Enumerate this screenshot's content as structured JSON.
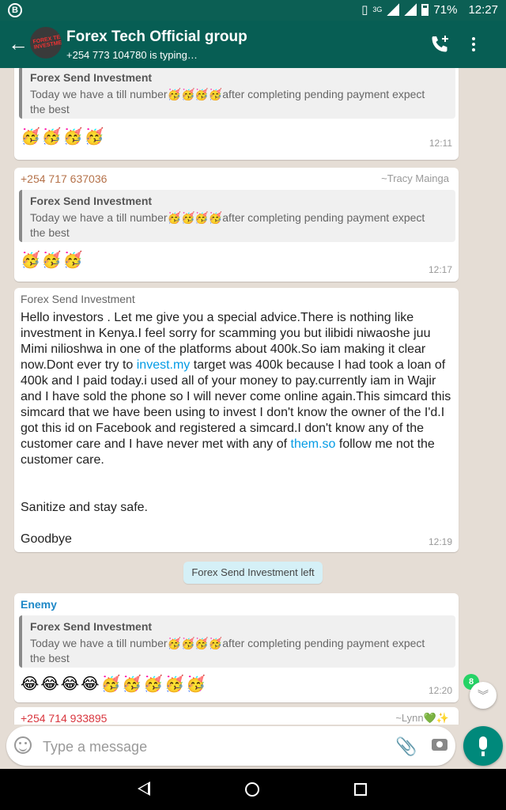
{
  "status_bar": {
    "network": "3G",
    "battery": "71%",
    "time": "12:27"
  },
  "header": {
    "back_icon": "arrow-left-icon",
    "avatar_text": "FOREX TECH INVESTMENT",
    "title": "Forex Tech Official group",
    "subtitle": "+254 773 104780 is typing…",
    "call_icon": "add-call-icon",
    "menu_icon": "more-vert-icon"
  },
  "messages": [
    {
      "quote_name": "Forex Send Investment",
      "quote_text": "Today we have a till number🥳🥳🥳🥳after completing pending payment expect the best",
      "emojis": "🥳🥳🥳🥳",
      "time": "12:11"
    },
    {
      "sender": "+254 717 637036",
      "alias": "~Tracy Mainga",
      "quote_name": "Forex Send Investment",
      "quote_text": "Today we have a till number🥳🥳🥳🥳after completing pending payment expect the best",
      "emojis": "🥳🥳🥳",
      "time": "12:17"
    },
    {
      "sender": "Forex Send Investment",
      "text_a": "Hello investors . Let me give you a special advice.There is nothing like investment in Kenya.I feel sorry for scamming you but ilibidi niwaoshe juu Mimi nilioshwa in one of the platforms about 400k.So iam making it clear now.Dont ever try to ",
      "link_a": "invest.my",
      "text_b": " target was 400k because I had took a loan of 400k and I paid today.i used all of your money to pay.currently iam in Wajir and I have sold the phone so I will never come online again.This simcard this simcard that we have been using to invest I don't know the owner of the I'd.I got this id on Facebook and registered a simcard.I don't know any of the customer care and I have never met with any of ",
      "link_b": "them.so",
      "text_c": " follow me not the customer care.",
      "text_d": "Sanitize and stay safe.",
      "text_e": "Goodbye",
      "time": "12:19"
    },
    {
      "system": "Forex Send Investment left"
    },
    {
      "sender": "Enemy",
      "quote_name": "Forex Send Investment",
      "quote_text": "Today we have a till number🥳🥳🥳🥳after completing pending payment expect the best",
      "emojis": "😂😂😂😂🥳🥳🥳🥳🥳",
      "time": "12:20"
    },
    {
      "sender": "+254 714 933895",
      "alias": "~Lynn💚✨"
    }
  ],
  "unread_count": "8",
  "scroll_icon": "chevron-double-down-icon",
  "input": {
    "placeholder": "Type a message",
    "emoji_icon": "smiley-icon",
    "attach_icon": "paperclip-icon",
    "camera_icon": "camera-icon",
    "mic_icon": "microphone-icon"
  },
  "colors": {
    "header": "#075e54",
    "status_bar": "#0c5f54",
    "chat_bg": "#e5ddd5",
    "sender_tracy": "#b5724a",
    "sender_enemy": "#1e88c7",
    "sender_lynn": "#d9363e",
    "link": "#039be5",
    "mic": "#00897b"
  }
}
